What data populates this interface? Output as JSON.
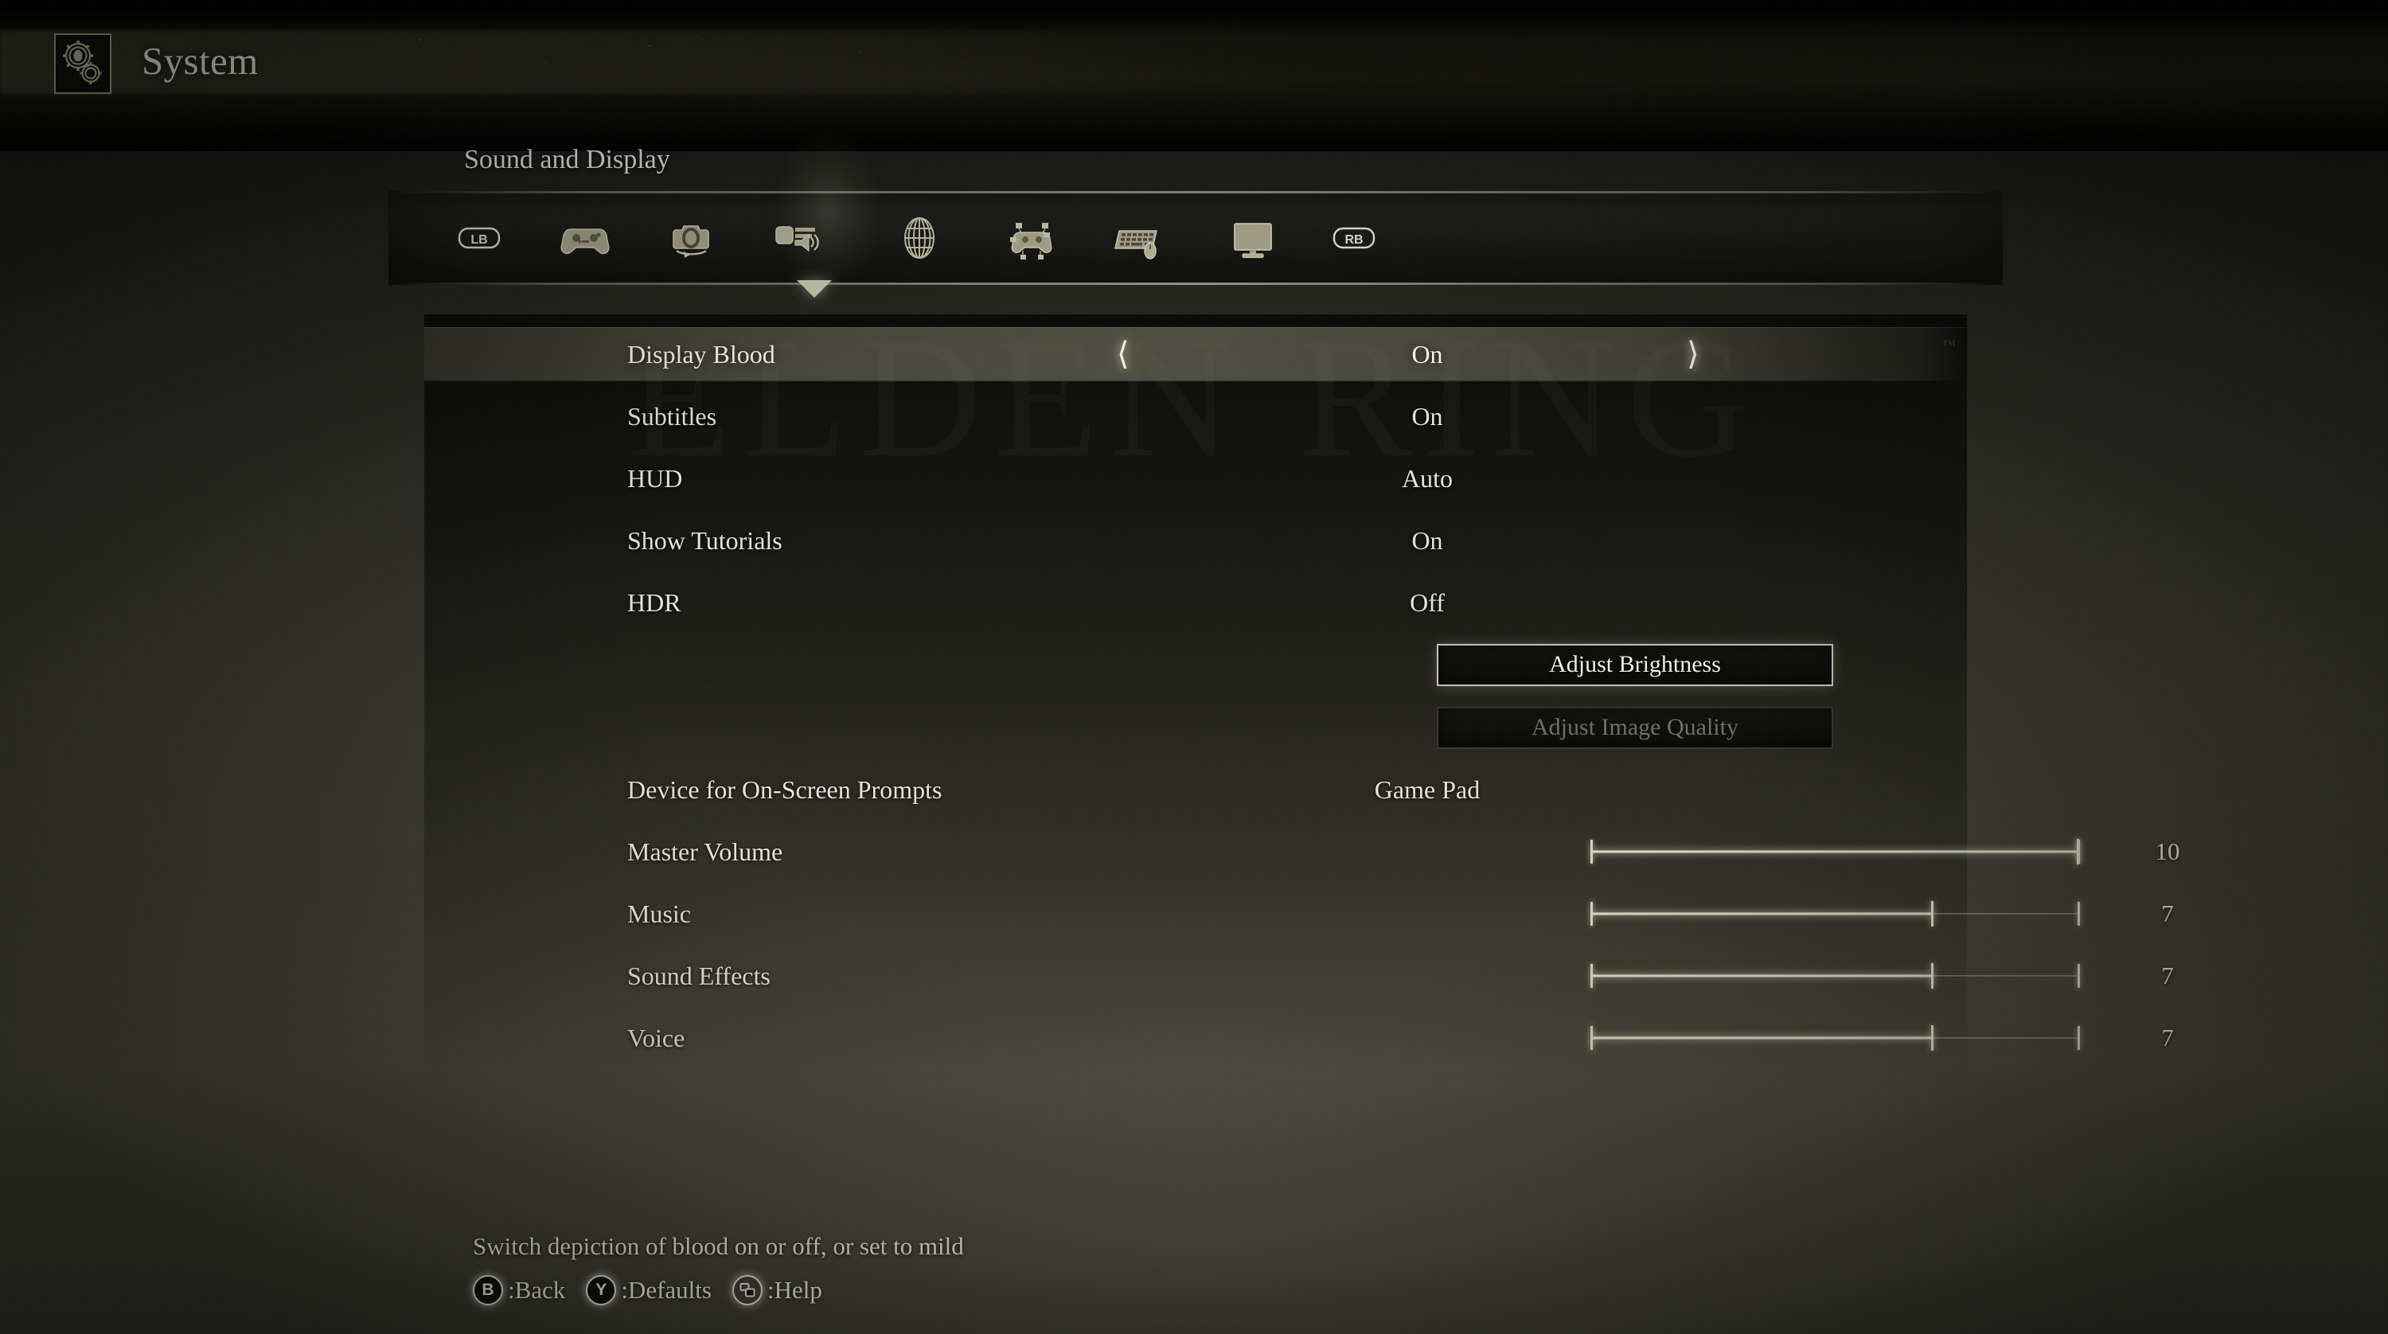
{
  "header": {
    "title": "System",
    "icon": "gears-icon"
  },
  "section": {
    "title": "Sound and Display"
  },
  "tabs": [
    {
      "id": "lb-bumper",
      "label": "LB",
      "icon": "lb-bumper-icon",
      "selected": false
    },
    {
      "id": "gameplay",
      "label": "Gameplay",
      "icon": "gamepad-icon",
      "selected": false
    },
    {
      "id": "camera",
      "label": "Camera",
      "icon": "camera-rotate-icon",
      "selected": false
    },
    {
      "id": "sound-display",
      "label": "Sound and Display",
      "icon": "sound-display-icon",
      "selected": true
    },
    {
      "id": "network",
      "label": "Network",
      "icon": "globe-icon",
      "selected": false
    },
    {
      "id": "controls-gamepad",
      "label": "Controls (Gamepad)",
      "icon": "gamepad-mapping-icon",
      "selected": false
    },
    {
      "id": "keyboard-mouse",
      "label": "Keyboard/Mouse",
      "icon": "keyboard-mouse-icon",
      "selected": false
    },
    {
      "id": "graphics",
      "label": "Graphics",
      "icon": "monitor-icon",
      "selected": false
    },
    {
      "id": "rb-bumper",
      "label": "RB",
      "icon": "rb-bumper-icon",
      "selected": false
    }
  ],
  "watermark": "ELDEN RING",
  "trademark": "™",
  "settings": [
    {
      "type": "option",
      "label": "Display Blood",
      "value": "On",
      "selected": true,
      "arrows": true
    },
    {
      "type": "option",
      "label": "Subtitles",
      "value": "On",
      "selected": false,
      "arrows": false
    },
    {
      "type": "option",
      "label": "HUD",
      "value": "Auto",
      "selected": false,
      "arrows": false
    },
    {
      "type": "option",
      "label": "Show Tutorials",
      "value": "On",
      "selected": false,
      "arrows": false
    },
    {
      "type": "option",
      "label": "HDR",
      "value": "Off",
      "selected": false,
      "arrows": false
    },
    {
      "type": "button",
      "label": "Adjust Brightness",
      "enabled": true
    },
    {
      "type": "button",
      "label": "Adjust Image Quality",
      "enabled": false
    },
    {
      "type": "option",
      "label": "Device for On-Screen Prompts",
      "value": "Game Pad",
      "selected": false,
      "arrows": false
    },
    {
      "type": "slider",
      "label": "Master Volume",
      "value": 10,
      "max": 10
    },
    {
      "type": "slider",
      "label": "Music",
      "value": 7,
      "max": 10
    },
    {
      "type": "slider",
      "label": "Sound Effects",
      "value": 7,
      "max": 10
    },
    {
      "type": "slider",
      "label": "Voice",
      "value": 7,
      "max": 10
    }
  ],
  "footer": {
    "description": "Switch depiction of blood on or off, or set to mild",
    "prompts": [
      {
        "glyph": "B",
        "icon": "button-b-icon",
        "style": "filled",
        "label": ":Back"
      },
      {
        "glyph": "Y",
        "icon": "button-y-icon",
        "style": "filled",
        "label": ":Defaults"
      },
      {
        "glyph": "",
        "icon": "button-view-icon",
        "style": "hollow",
        "label": ":Help"
      }
    ]
  },
  "colors": {
    "text": "#e8e6d9",
    "text_bright": "#f6f4ea",
    "accent": "#c9c8ae",
    "background": "#3b3b31",
    "panel": "#0a0a08",
    "disabled": "#c4c1ac"
  }
}
